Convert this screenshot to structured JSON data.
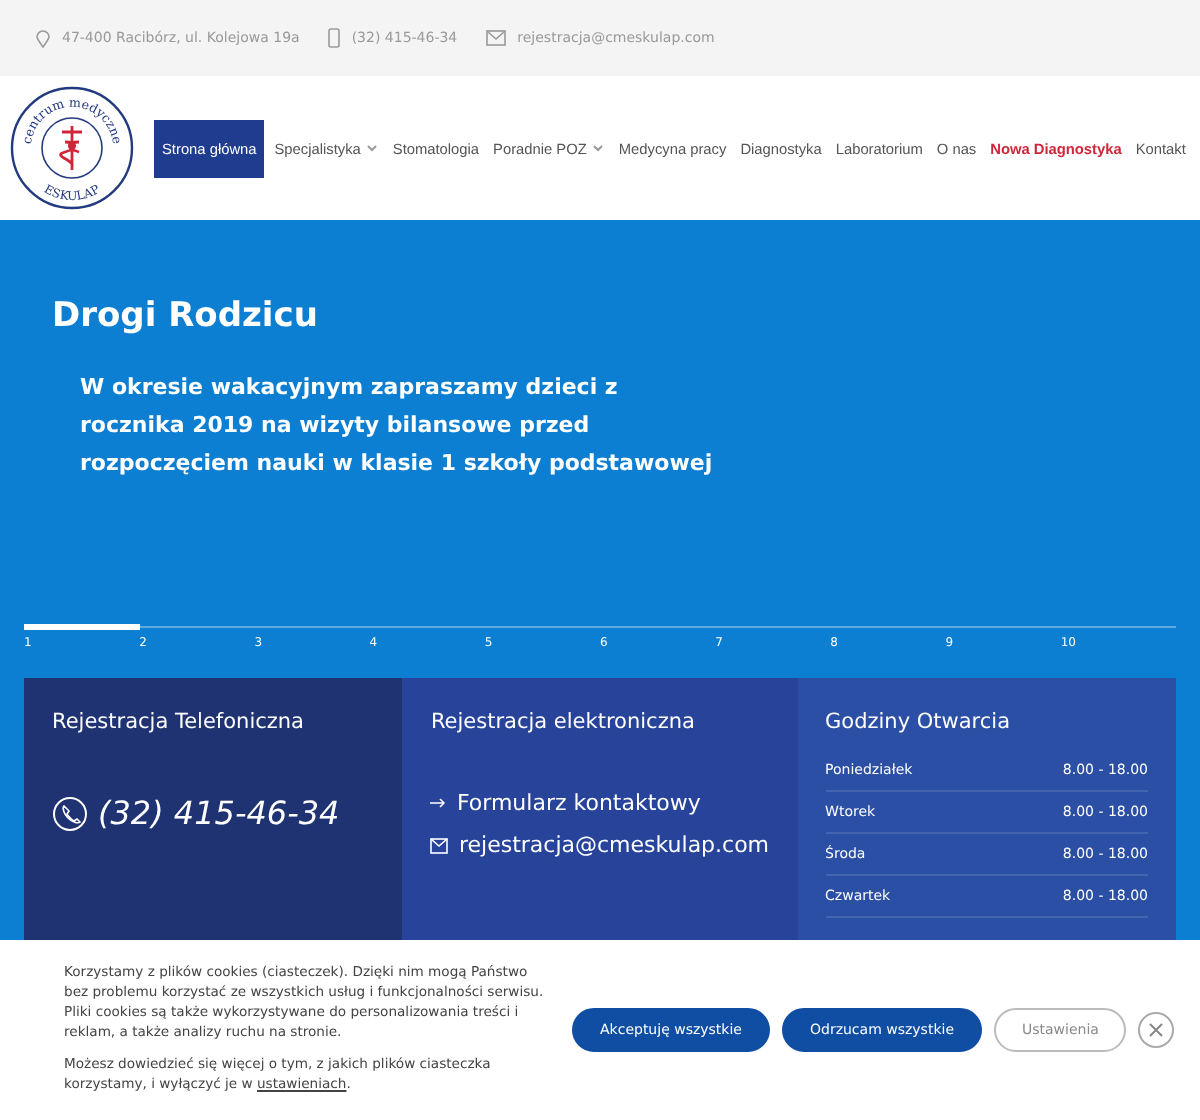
{
  "topbar": {
    "address": "47-400 Racibórz, ul. Kolejowa 19a",
    "phone": "(32) 415-46-34",
    "email": "rejestracja@cmeskulap.com"
  },
  "logo": {
    "top_text": "centrum medyczne",
    "bottom_text": "ESKULAP"
  },
  "nav": [
    {
      "label": "Strona główna",
      "selected": true,
      "dropdown": false,
      "accent": false
    },
    {
      "label": "Specjalistyka",
      "selected": false,
      "dropdown": true,
      "accent": false
    },
    {
      "label": "Stomatologia",
      "selected": false,
      "dropdown": false,
      "accent": false
    },
    {
      "label": "Poradnie POZ",
      "selected": false,
      "dropdown": true,
      "accent": false
    },
    {
      "label": "Medycyna pracy",
      "selected": false,
      "dropdown": false,
      "accent": false
    },
    {
      "label": "Diagnostyka",
      "selected": false,
      "dropdown": false,
      "accent": false
    },
    {
      "label": "Laboratorium",
      "selected": false,
      "dropdown": false,
      "accent": false
    },
    {
      "label": "O nas",
      "selected": false,
      "dropdown": false,
      "accent": false
    },
    {
      "label": "Nowa Diagnostyka",
      "selected": false,
      "dropdown": false,
      "accent": true
    },
    {
      "label": "Kontakt",
      "selected": false,
      "dropdown": false,
      "accent": false
    }
  ],
  "hero": {
    "title": "Drogi Rodzicu",
    "text": "W okresie wakacyjnym zapraszamy dzieci z rocznika 2019 na wizyty bilansowe przed rozpoczęciem nauki w klasie 1 szkoły podstawowej"
  },
  "slides": [
    {
      "label": "1",
      "selected": true
    },
    {
      "label": "2",
      "selected": false
    },
    {
      "label": "3",
      "selected": false
    },
    {
      "label": "4",
      "selected": false
    },
    {
      "label": "5",
      "selected": false
    },
    {
      "label": "6",
      "selected": false
    },
    {
      "label": "7",
      "selected": false
    },
    {
      "label": "8",
      "selected": false
    },
    {
      "label": "9",
      "selected": false
    },
    {
      "label": "10",
      "selected": false
    }
  ],
  "cards": {
    "phone": {
      "title": "Rejestracja Telefoniczna",
      "number": "(32) 415-46-34"
    },
    "online": {
      "title": "Rejestracja elektroniczna",
      "form_link": "Formularz kontaktowy",
      "email": "rejestracja@cmeskulap.com"
    },
    "hours": {
      "title": "Godziny Otwarcia",
      "rows": [
        {
          "day": "Poniedziałek",
          "time": "8.00 - 18.00"
        },
        {
          "day": "Wtorek",
          "time": "8.00 - 18.00"
        },
        {
          "day": "Środa",
          "time": "8.00 - 18.00"
        },
        {
          "day": "Czwartek",
          "time": "8.00 - 18.00"
        }
      ]
    }
  },
  "cookie": {
    "text": "Korzystamy z plików cookies (ciasteczek). Dzięki nim mogą Państwo bez problemu korzystać ze wszystkich usług i funkcjonalności serwisu. Pliki cookies są także wykorzystywane do personalizowania treści i reklam, a także analizy ruchu na stronie.",
    "more_text": "Możesz dowiedzieć się więcej o tym, z jakich plików ciasteczka korzystamy, i wyłączyć je w",
    "more_link": "ustawieniach",
    "more_end": ".",
    "buttons": [
      {
        "label": "Akceptuję wszystkie",
        "kind": "primary"
      },
      {
        "label": "Odrzucam wszystkie",
        "kind": "primary"
      },
      {
        "label": "Ustawienia",
        "kind": "outline"
      }
    ]
  }
}
